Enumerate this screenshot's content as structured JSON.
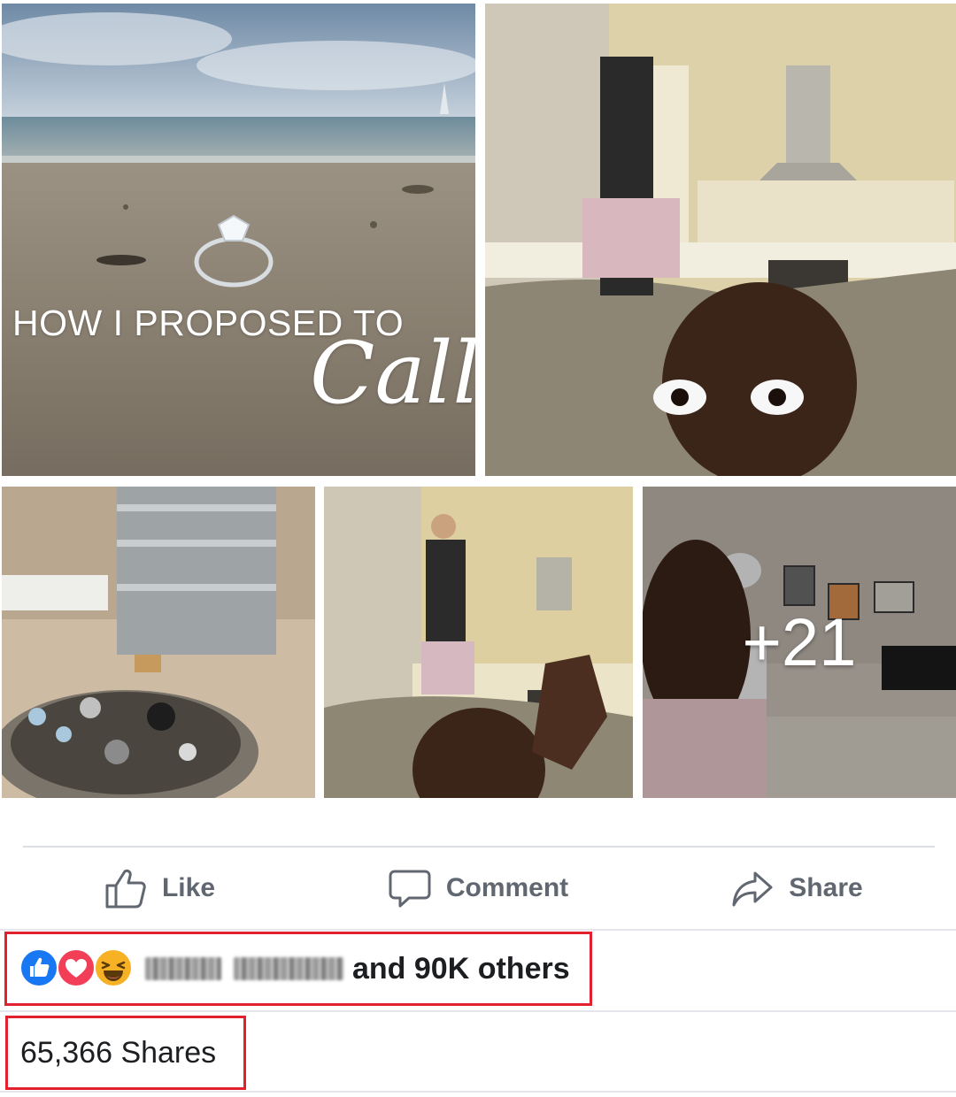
{
  "post": {
    "photos": [
      {
        "name": "beach-ring-title-photo",
        "overlay_title": "HOW I PROPOSED TO",
        "overlay_script": "Cally"
      },
      {
        "name": "kitchen-selfie-photo"
      },
      {
        "name": "jewellery-dish-photo"
      },
      {
        "name": "kitchen-wave-photo"
      },
      {
        "name": "living-room-selfie-photo",
        "more_count": "+21"
      }
    ]
  },
  "actions": {
    "like_label": "Like",
    "comment_label": "Comment",
    "share_label": "Share"
  },
  "reactions": {
    "icons": [
      "like-reaction-icon",
      "love-reaction-icon",
      "haha-reaction-icon"
    ],
    "summary": "and 90K others"
  },
  "shares": {
    "count_label": "65,366 Shares"
  },
  "colors": {
    "like_blue": "#1877f2",
    "love_red": "#f33e58",
    "haha_yellow": "#f7b125",
    "action_gray": "#606770",
    "highlight_red": "#e3202e"
  }
}
